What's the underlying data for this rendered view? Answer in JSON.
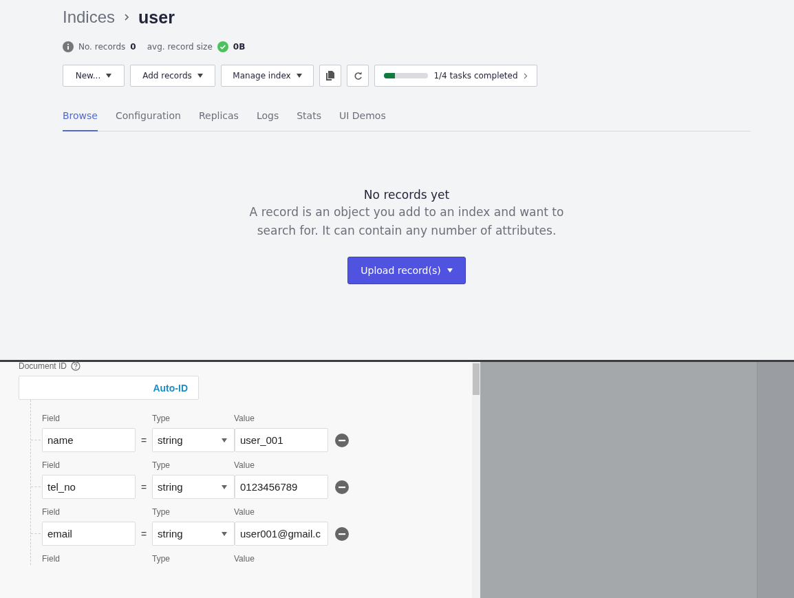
{
  "breadcrumb": {
    "parent": "Indices",
    "current": "user"
  },
  "stats": [
    {
      "label": "No. records",
      "value": "0",
      "kind": "info"
    },
    {
      "label": "avg. record size",
      "value": "0B",
      "kind": "ok"
    }
  ],
  "toolbar": {
    "menus": [
      "New...",
      "Add records",
      "Manage index"
    ],
    "icon_buttons": [
      {
        "kind": "copy"
      },
      {
        "kind": "refresh"
      }
    ],
    "tasks": {
      "label": "1/4 tasks completed",
      "level": 0.25
    }
  },
  "tabs": [
    {
      "label": "Browse",
      "selected": true
    },
    {
      "label": "Configuration",
      "selected": false
    },
    {
      "label": "Replicas",
      "selected": false
    },
    {
      "label": "Logs",
      "selected": false
    },
    {
      "label": "Stats",
      "selected": false
    },
    {
      "label": "UI Demos",
      "selected": false
    }
  ],
  "empty_state": {
    "title": "No records yet",
    "description": "A record is an object you add to an index and want to search for. It can contain any number of attributes.",
    "button": "Upload record(s)"
  },
  "document_form": {
    "id_label": "Document ID",
    "id_button": "Auto-ID",
    "fields": [
      {
        "field_label": "Field",
        "type_label": "Type",
        "value_label": "Value",
        "field": "name",
        "type": "string",
        "value": "user_001"
      },
      {
        "field_label": "Field",
        "type_label": "Type",
        "value_label": "Value",
        "field": "tel_no",
        "type": "string",
        "value": "0123456789"
      },
      {
        "field_label": "Field",
        "type_label": "Type",
        "value_label": "Value",
        "field": "email",
        "type": "string",
        "value": "user001@gmail.c"
      }
    ],
    "next_labels": {
      "field_label": "Field",
      "type_label": "Type",
      "value_label": "Value"
    },
    "equals": "="
  }
}
